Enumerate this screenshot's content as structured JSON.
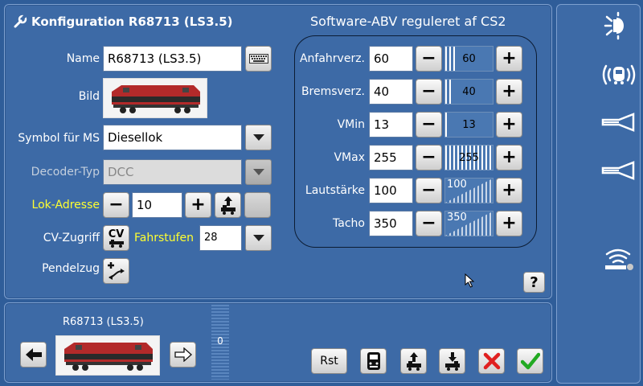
{
  "header": {
    "title": "Konfiguration R68713 (LS3.5)",
    "icon": "wrench-icon"
  },
  "form": {
    "name_label": "Name",
    "name_value": "R68713 (LS3.5)",
    "bild_label": "Bild",
    "symbol_label": "Symbol für MS",
    "symbol_value": "Diesellok",
    "decoder_label": "Decoder-Typ",
    "decoder_value": "DCC",
    "address_label": "Lok-Adresse",
    "address_value": "10",
    "cv_label": "CV-Zugriff",
    "cv_button": "CV",
    "fahrstufen_label": "Fahrstufen",
    "fahrstufen_value": "28",
    "pendel_label": "Pendelzug"
  },
  "abv": {
    "title": "Software-ABV reguleret af CS2",
    "rows": [
      {
        "label": "Anfahrverz.",
        "value": "60",
        "bar": "60",
        "fraction": 0.235,
        "style": "flat"
      },
      {
        "label": "Bremsverz.",
        "value": "40",
        "bar": "40",
        "fraction": 0.157,
        "style": "flat"
      },
      {
        "label": "VMin",
        "value": "13",
        "bar": "13",
        "fraction": 0.051,
        "style": "flat"
      },
      {
        "label": "VMax",
        "value": "255",
        "bar": "255",
        "fraction": 1.0,
        "style": "flat"
      },
      {
        "label": "Lautstärke",
        "value": "100",
        "bar": "100",
        "fraction": 0.5,
        "style": "ramp"
      },
      {
        "label": "Tacho",
        "value": "350",
        "bar": "350",
        "fraction": 0.5,
        "style": "ramp"
      }
    ],
    "minus": "−",
    "plus": "+",
    "help": "?"
  },
  "bottom": {
    "loco_name": "R68713 (LS3.5)",
    "speed_value": "0",
    "rst_label": "Rst"
  },
  "colors": {
    "accent_yellow": "#ffff30",
    "panel": "#3d6aa6",
    "cancel": "#e02020",
    "ok": "#22aa22"
  }
}
